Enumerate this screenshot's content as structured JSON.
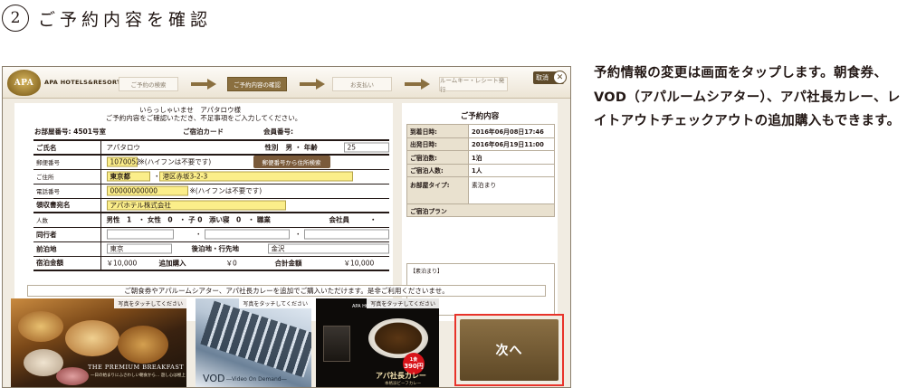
{
  "heading": {
    "step_number": "2",
    "title": "ご予約内容を確認"
  },
  "description": "予約情報の変更は画面をタップします。朝食券、VOD（アパルームシアター）、アパ社長カレー、レイトアウトチェックアウトの追加購入もできます。",
  "kiosk": {
    "logo_text": "APA",
    "brand": "APA HOTELS&RESORTS",
    "steps": [
      "ご予約の検索",
      "ご予約内容の確認",
      "お支払い",
      "ルームキー・レシート発行"
    ],
    "active_step": 1,
    "cancel_label": "取消",
    "close_glyph": "✕",
    "welcome_line1": "いらっしゃいませ　アパタロウ様",
    "welcome_line2": "ご予約内容をご確認いただき、不足事項をご入力してください。",
    "room_label": "お部屋番号: 4501号室",
    "card_label": "ご宿泊カード",
    "member_label": "会員番号:",
    "form": {
      "name_label": "ご氏名",
      "name_value": "アパタロウ",
      "gender_label": "性別",
      "gender_value": "男 ・ 年齢",
      "age_value": "25",
      "postal_label": "郵便番号",
      "postal_value": "1070052",
      "postal_note": "※(ハイフンは不要です)",
      "postal_button": "郵便番号から住所検索",
      "address_label": "ご住所",
      "address_pref": "東京都",
      "address_sep": "・",
      "address_detail": "港区赤坂3-2-3",
      "phone_label": "電話番号",
      "phone_value": "00000000000",
      "phone_note": "※(ハイフンは不要です)",
      "receipt_label": "領収書宛名",
      "receipt_value": "アパホテル株式会社",
      "people_label": "人数",
      "people_value": "男性　1　・ 女性　0　・ 子 0　添い寝　0　・ 職業",
      "job_value": "会社員　　　・",
      "companion_label": "同行者",
      "companion_sep1": "・",
      "companion_sep2": "・",
      "prev_label": "前泊地",
      "prev_value": "東京",
      "next_label": "後泊地・行先地",
      "next_value": "金沢",
      "amount_label": "宿泊金額",
      "amount_value": "￥10,000",
      "extra_label": "追加購入",
      "extra_value": "￥0",
      "total_label": "合計金額",
      "total_value": "￥10,000"
    },
    "summary": {
      "title": "ご予約内容",
      "rows": [
        {
          "k": "到着日時:",
          "v": "2016年06月08日17:46"
        },
        {
          "k": "出発日時:",
          "v": "2016年06月19日11:00"
        },
        {
          "k": "ご宿泊数:",
          "v": "1泊"
        },
        {
          "k": "ご宿泊人数:",
          "v": "1人"
        },
        {
          "k": "お部屋タイプ:",
          "v": "素泊まり"
        }
      ],
      "plan_label": "ご宿泊プラン",
      "plan_value": "【素泊まり】"
    },
    "promo_notice": "ご朝食券やアパルームシアター、アパ社長カレーを追加でご購入いただけます。是非ご利用くださいませ。",
    "tile_label": "写真をタッチしてください",
    "breakfast_caption": "THE PREMIUM BREAKFAST",
    "breakfast_sub": "一日の始まりにふさわしい朝食から... 遊し心は極上",
    "vod_title": "VOD",
    "vod_sub": "―Video On Demand―",
    "curry_brand": "APA HOTELS&RESORTS",
    "curry_price_top": "1食",
    "curry_price": "390円",
    "curry_title": "アパ社長カレー",
    "curry_sub": "本格派ビーフカレー",
    "next_button": "次へ"
  }
}
